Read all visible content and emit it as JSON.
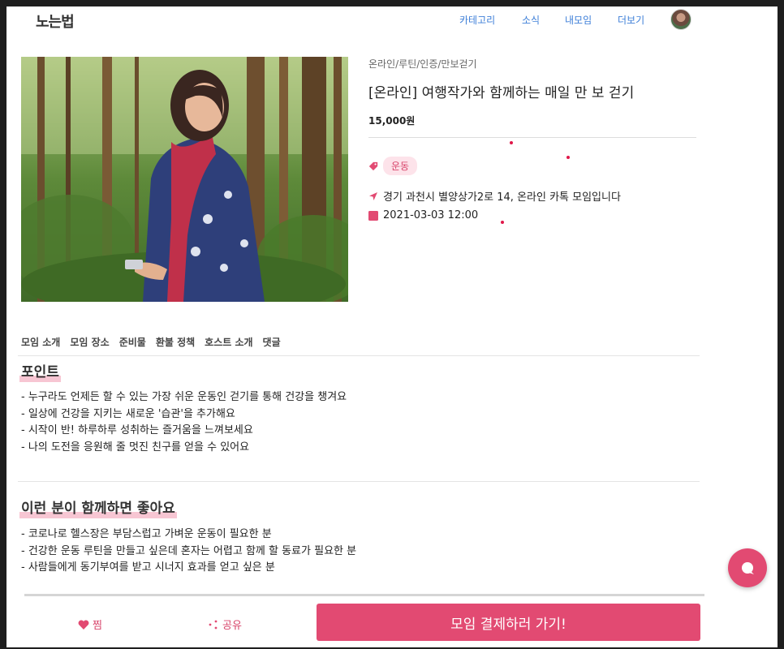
{
  "header": {
    "logo": "노는법",
    "nav": [
      "카테고리",
      "소식",
      "내모임",
      "더보기"
    ]
  },
  "detail": {
    "category": "온라인/루틴/인증/만보걷기",
    "title": "[온라인] 여행작가와 함께하는 매일 만 보 걷기",
    "price": "15,000원",
    "tag": "운동",
    "location": "경기 과천시 별양상가2로 14, 온라인 카톡 모임입니다",
    "datetime": "2021-03-03 12:00"
  },
  "tabs": [
    "모임 소개",
    "모임 장소",
    "준비물",
    "환불 정책",
    "호스트 소개",
    "댓글"
  ],
  "sections": [
    {
      "title": "포인트",
      "items": [
        "- 누구라도 언제든 할 수 있는 가장 쉬운 운동인 걷기를 통해 건강을 챙겨요",
        "- 일상에 건강을 지키는 새로운 '습관'을 추가해요",
        "- 시작이 반! 하루하루 성취하는 즐거움을 느껴보세요",
        "- 나의 도전을 응원해 줄 멋진 친구를 얻을 수 있어요"
      ]
    },
    {
      "title": "이런 분이 함께하면 좋아요",
      "items": [
        "- 코로나로 헬스장은 부담스럽고 가벼운 운동이 필요한 분",
        "- 건강한 운동 루틴을 만들고 싶은데 혼자는 어렵고 함께 할 동료가 필요한 분",
        "- 사람들에게 동기부여를 받고 시너지 효과를 얻고 싶은 분"
      ]
    }
  ],
  "bottom": {
    "like": "찜",
    "share": "공유",
    "pay": "모임 결제하러 가기!"
  },
  "colors": {
    "accent": "#e24a72",
    "nav": "#3e7fd8",
    "tag_bg": "#fde3ea"
  }
}
